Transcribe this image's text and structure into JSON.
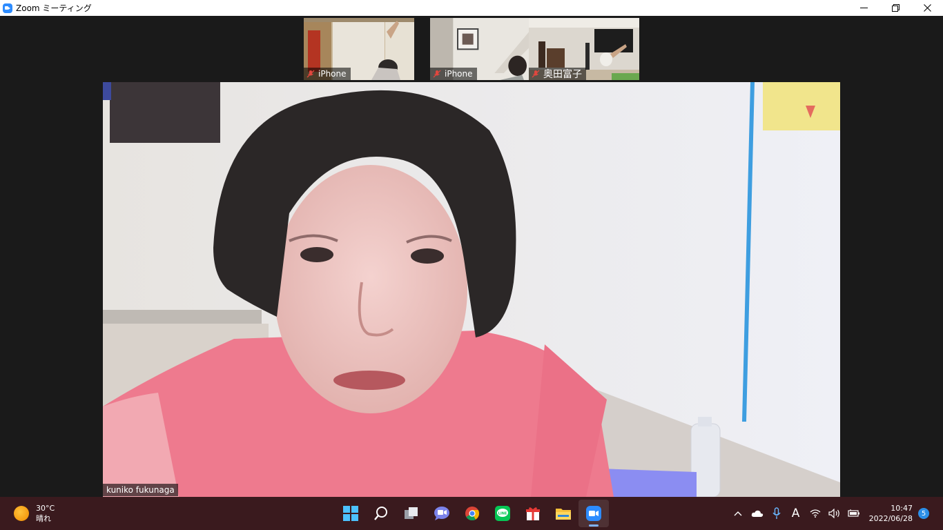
{
  "window": {
    "title": "Zoom ミーティング",
    "icon": "zoom-icon"
  },
  "participants": [
    {
      "name": "iPhone",
      "muted": true
    },
    {
      "name": "iPhone",
      "muted": true
    },
    {
      "name": "奥田富子",
      "muted": true
    }
  ],
  "active_speaker": {
    "name": "kuniko fukunaga"
  },
  "taskbar": {
    "weather": {
      "temperature": "30°C",
      "condition": "晴れ",
      "icon": "sun-icon"
    },
    "apps": [
      "windows-start-icon",
      "search-icon",
      "task-view-icon",
      "teams-chat-icon",
      "chrome-icon",
      "line-icon",
      "gift-icon",
      "file-explorer-icon",
      "zoom-icon"
    ],
    "active_app": "zoom-icon",
    "tray": {
      "time": "10:47",
      "date": "2022/06/28",
      "notifications": "5",
      "ime": "A"
    }
  },
  "colors": {
    "zoom_blue": "#2d8cff",
    "taskbar_bg": "#3a1a1e",
    "stage_bg": "#1a1a1a"
  }
}
